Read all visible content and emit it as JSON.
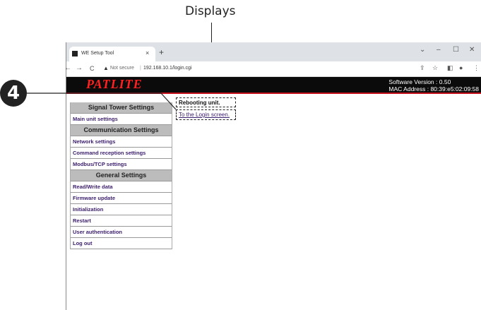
{
  "callout": {
    "label": "Displays",
    "step_number": "4"
  },
  "browser": {
    "tab_title": "WE Setup Tool",
    "tab_close": "×",
    "new_tab": "+",
    "win_controls": {
      "chevron": "⌄",
      "minimize": "–",
      "maximize": "☐",
      "close": "✕"
    },
    "nav": {
      "back": "←",
      "forward": "→",
      "reload": "C"
    },
    "security_label": "Not secure",
    "url": "192.168.10.1/login.cgi"
  },
  "header": {
    "logo": "PATLITE",
    "software_version": "Software Version : 0.50",
    "mac_address": "MAC Address : 80:39:e5:02:09:58"
  },
  "sidebar": {
    "sections": [
      {
        "title": "Signal Tower Settings",
        "items": [
          "Main unit settings"
        ]
      },
      {
        "title": "Communication Settings",
        "items": [
          "Network settings",
          "Command reception settings",
          "Modbus/TCP settings"
        ]
      },
      {
        "title": "General Settings",
        "items": [
          "Read/Write data",
          "Firmware update",
          "Initialization",
          "Restart",
          "User authentication",
          "Log out"
        ]
      }
    ]
  },
  "content": {
    "message": "Rebooting unit.",
    "login_link": "To the Login screen."
  },
  "colors": {
    "header_bg": "#0b0b0b",
    "logo": "#ff2020",
    "header_border": "#c4121d",
    "link": "#3b1d6e",
    "section_bg": "#bcbcbc"
  },
  "icons": [
    "favicon-icon",
    "back-icon",
    "forward-icon",
    "reload-icon",
    "warning-icon",
    "share-icon",
    "star-icon",
    "sidebar-icon",
    "profile-icon",
    "menu-icon"
  ]
}
